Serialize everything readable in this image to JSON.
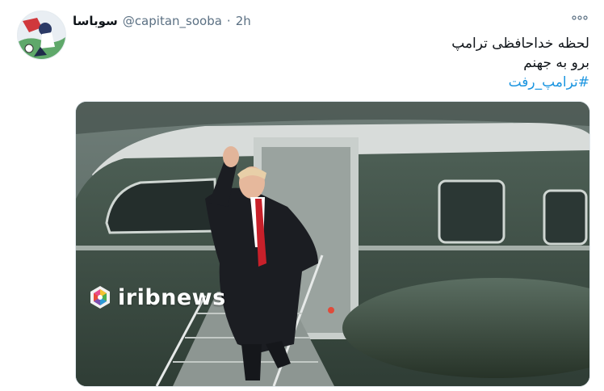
{
  "tweet": {
    "author_name": "سوباسا",
    "handle": "@capitan_sooba",
    "separator": "·",
    "time": "2h",
    "more_icon": "ellipsis-icon",
    "lines": [
      "لحظه خداحافظی ترامپ",
      "برو به جهنم"
    ],
    "hashtag": "#ترامپ_رفت"
  },
  "media": {
    "watermark": "iribnews",
    "logo_icon": "iribnews-logo-icon"
  }
}
